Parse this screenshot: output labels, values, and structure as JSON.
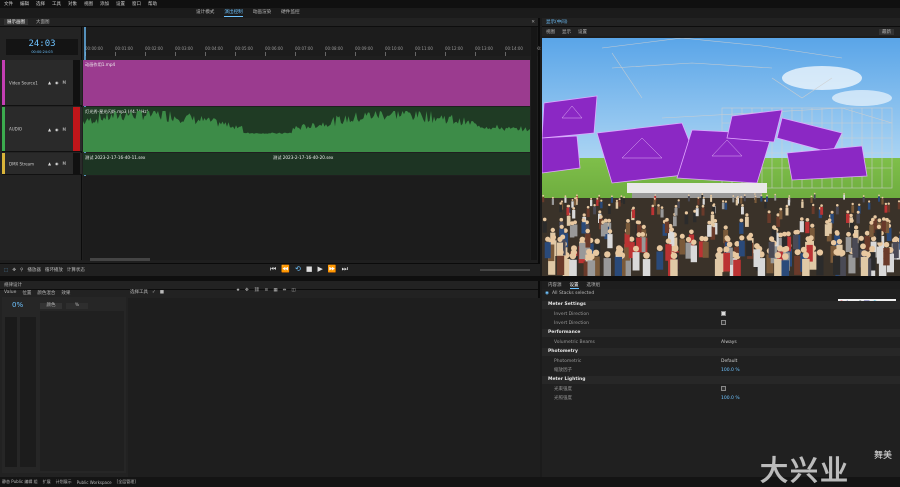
{
  "menubar": [
    "文件",
    "编辑",
    "选择",
    "工具",
    "对象",
    "视图",
    "添加",
    "设置",
    "窗口",
    "帮助"
  ],
  "mode_tabs": [
    {
      "label": "设计模式",
      "active": false
    },
    {
      "label": "演出控制",
      "active": true
    },
    {
      "label": "动画渲染",
      "active": false
    },
    {
      "label": "硬件监控",
      "active": false
    }
  ],
  "timeline": {
    "tabs": [
      "展示画图",
      "大面图"
    ],
    "test_button": "测试",
    "timecode": "24:03",
    "timecode_sub": "00:00:24:03",
    "ruler": [
      "00:00:00",
      "00:01:00",
      "00:02:00",
      "00:03:00",
      "00:04:00",
      "00:05:00",
      "00:06:00",
      "00:07:00",
      "00:08:00",
      "00:09:00",
      "00:10:00",
      "00:11:00",
      "00:12:00",
      "00:13:00",
      "00:14:00",
      "00:15:00"
    ],
    "tracks": [
      {
        "name": "Video Source1",
        "color": "#c43fb4",
        "clip_label": "动画作用1.mp4",
        "clip_color": "#9b3b8f"
      },
      {
        "name": "AUDIO",
        "color": "#3cab4e",
        "clip_label": "灯光秀-星光闪烁.mp3 (44.1kHz)",
        "clip_color": "#2c5a33"
      },
      {
        "name": "DMX Stream",
        "color": "#d9b43a",
        "clip_label": "测试 2023-2-17-16-40-11.sex",
        "clip_label2": "测试 2023-2-17-16-40-20.sex",
        "clip_color": "#1d3423"
      }
    ],
    "bottom_tools": [
      "播放器",
      "循环播放",
      "计算状态"
    ]
  },
  "behave": {
    "title": "规律设计",
    "tabs": [
      "Value",
      "位置",
      "颜色混合",
      "效果"
    ],
    "percent": "0%",
    "sub_tabs": [
      "颜色",
      "%"
    ],
    "tools_label": "选择工具"
  },
  "preview": {
    "title": "显示(中间)",
    "tabs": [
      "视图",
      "显示",
      "设置"
    ],
    "corner_button": "最新"
  },
  "props": {
    "tabs": [
      "内容源",
      "设置",
      "选项组"
    ],
    "active_tab": "设置",
    "header_item": "All Stacks selected",
    "sections": [
      {
        "title": "Meter Settings",
        "rows": [
          {
            "label": "Invert Direction",
            "type": "checkbox",
            "checked": true
          },
          {
            "label": "Invert Direction",
            "type": "checkbox",
            "checked": false
          }
        ]
      },
      {
        "title": "Performance",
        "rows": [
          {
            "label": "Volumetric Beams",
            "type": "text",
            "value": "Always"
          }
        ]
      },
      {
        "title": "Photometry",
        "rows": [
          {
            "label": "Photometric",
            "type": "text",
            "value": "Default"
          },
          {
            "label": "缩放因子",
            "type": "blue",
            "value": "100.0 %"
          }
        ]
      },
      {
        "title": "Meter Lighting",
        "rows": [
          {
            "label": "光束强度",
            "type": "checkbox",
            "checked": false
          },
          {
            "label": "光照强度",
            "type": "blue",
            "value": "100.0 %"
          }
        ]
      }
    ]
  },
  "statusbar": [
    "静态 Public 编辑 组",
    "扩展",
    "计划展示",
    "Public Workspace",
    "[全层管理]"
  ],
  "watermark": {
    "text": "大兴业",
    "sub": "舞美"
  },
  "colors": {
    "accent": "#6ec3ff"
  }
}
